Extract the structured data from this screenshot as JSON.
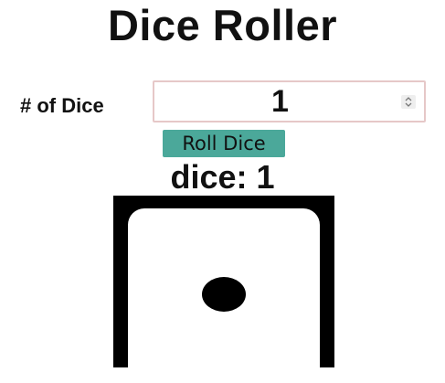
{
  "header": {
    "title": "Dice Roller"
  },
  "controls": {
    "count_label": "# of Dice",
    "count_value": "1",
    "roll_button_label": "Roll Dice"
  },
  "result": {
    "text": "dice: 1"
  },
  "dice": [
    {
      "value": 1,
      "pip_count": 1
    }
  ],
  "icons": {
    "spinner": "up-down-spinner-icon"
  },
  "colors": {
    "roll_button": "#4ba89a",
    "input_border": "#e6c8c8",
    "die_frame": "#000000"
  }
}
